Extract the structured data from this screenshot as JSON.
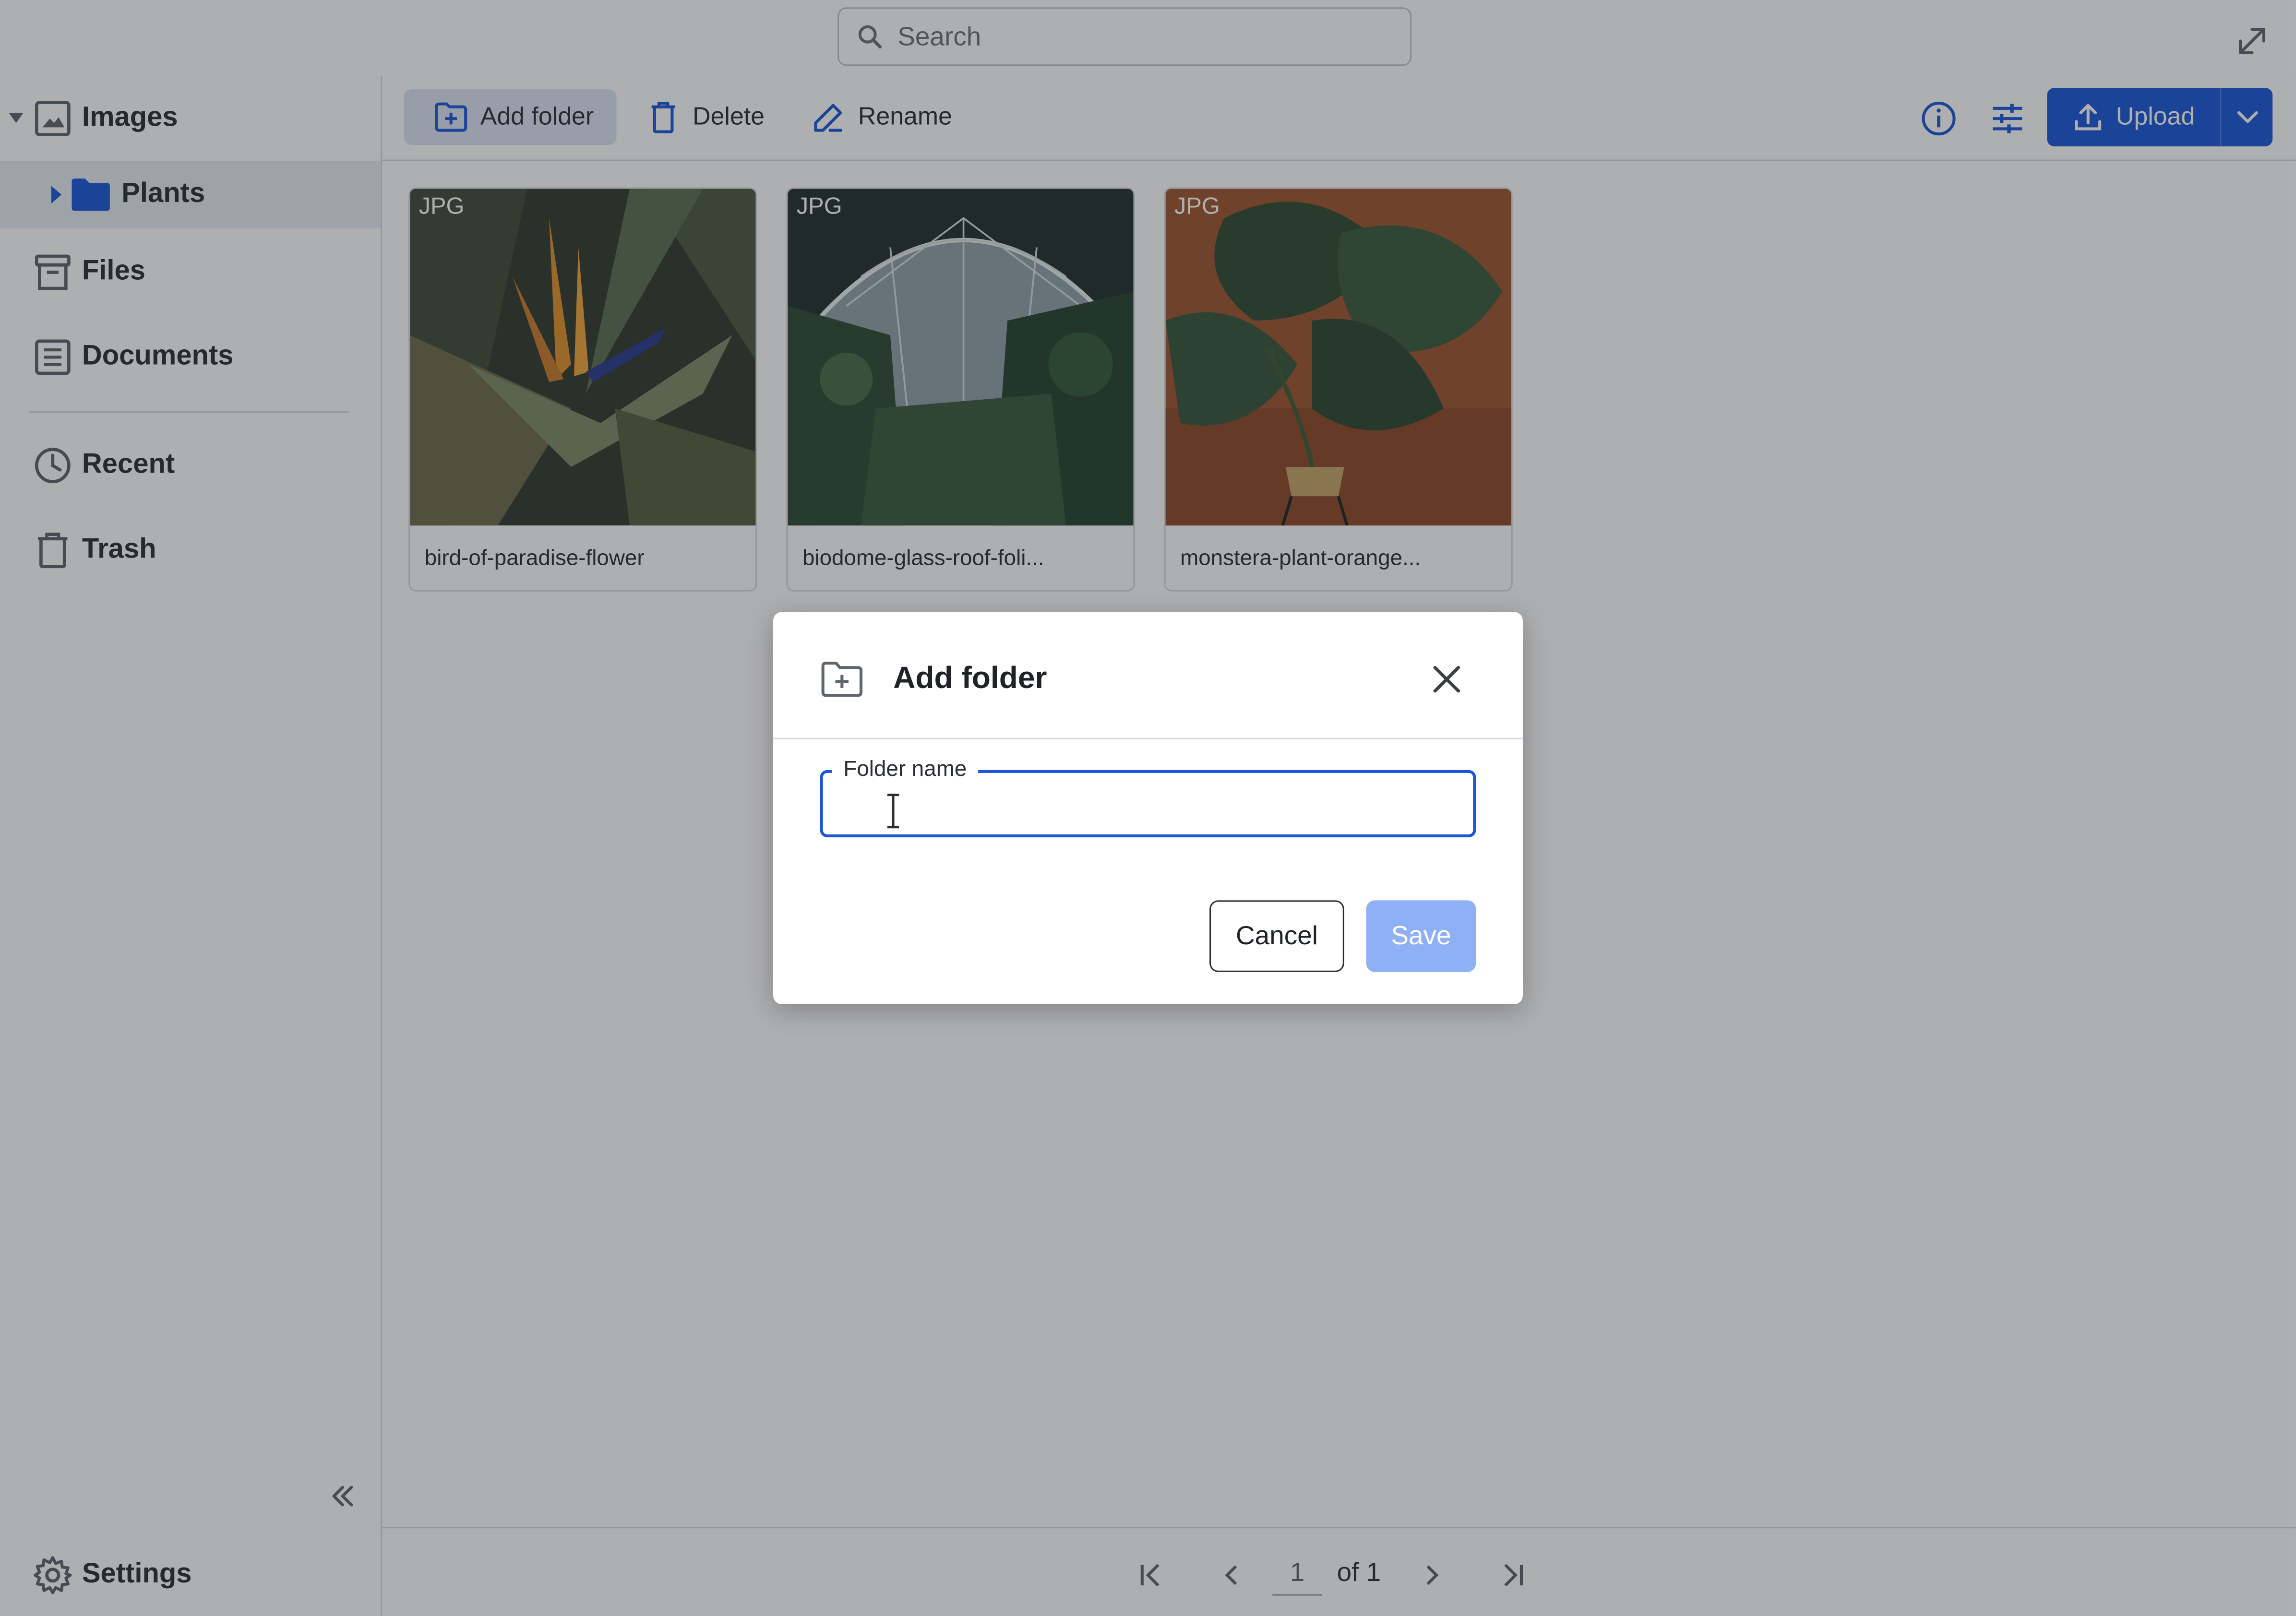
{
  "search": {
    "placeholder": "Search"
  },
  "sidebar": {
    "items": [
      {
        "label": "Images",
        "icon": "image-icon",
        "expanded": true
      },
      {
        "label": "Plants",
        "icon": "folder-icon",
        "nested": true,
        "selected": true
      },
      {
        "label": "Files",
        "icon": "archive-icon"
      },
      {
        "label": "Documents",
        "icon": "document-icon"
      },
      {
        "label": "Recent",
        "icon": "clock-icon"
      },
      {
        "label": "Trash",
        "icon": "trash-icon"
      }
    ],
    "settings_label": "Settings"
  },
  "toolbar": {
    "add_folder_label": "Add folder",
    "delete_label": "Delete",
    "rename_label": "Rename",
    "upload_label": "Upload"
  },
  "files": [
    {
      "type": "JPG",
      "name": "bird-of-paradise-flower"
    },
    {
      "type": "JPG",
      "name": "biodome-glass-roof-foli..."
    },
    {
      "type": "JPG",
      "name": "monstera-plant-orange..."
    }
  ],
  "pager": {
    "page": "1",
    "of_label": "of 1"
  },
  "dialog": {
    "title": "Add folder",
    "field_label": "Folder name",
    "field_value": "",
    "cancel_label": "Cancel",
    "save_label": "Save"
  },
  "colors": {
    "accent": "#1a56d6",
    "folder": "#1a56d6",
    "save_disabled": "#8fb0f4",
    "sidebar_selected": "#e6ebf2"
  }
}
